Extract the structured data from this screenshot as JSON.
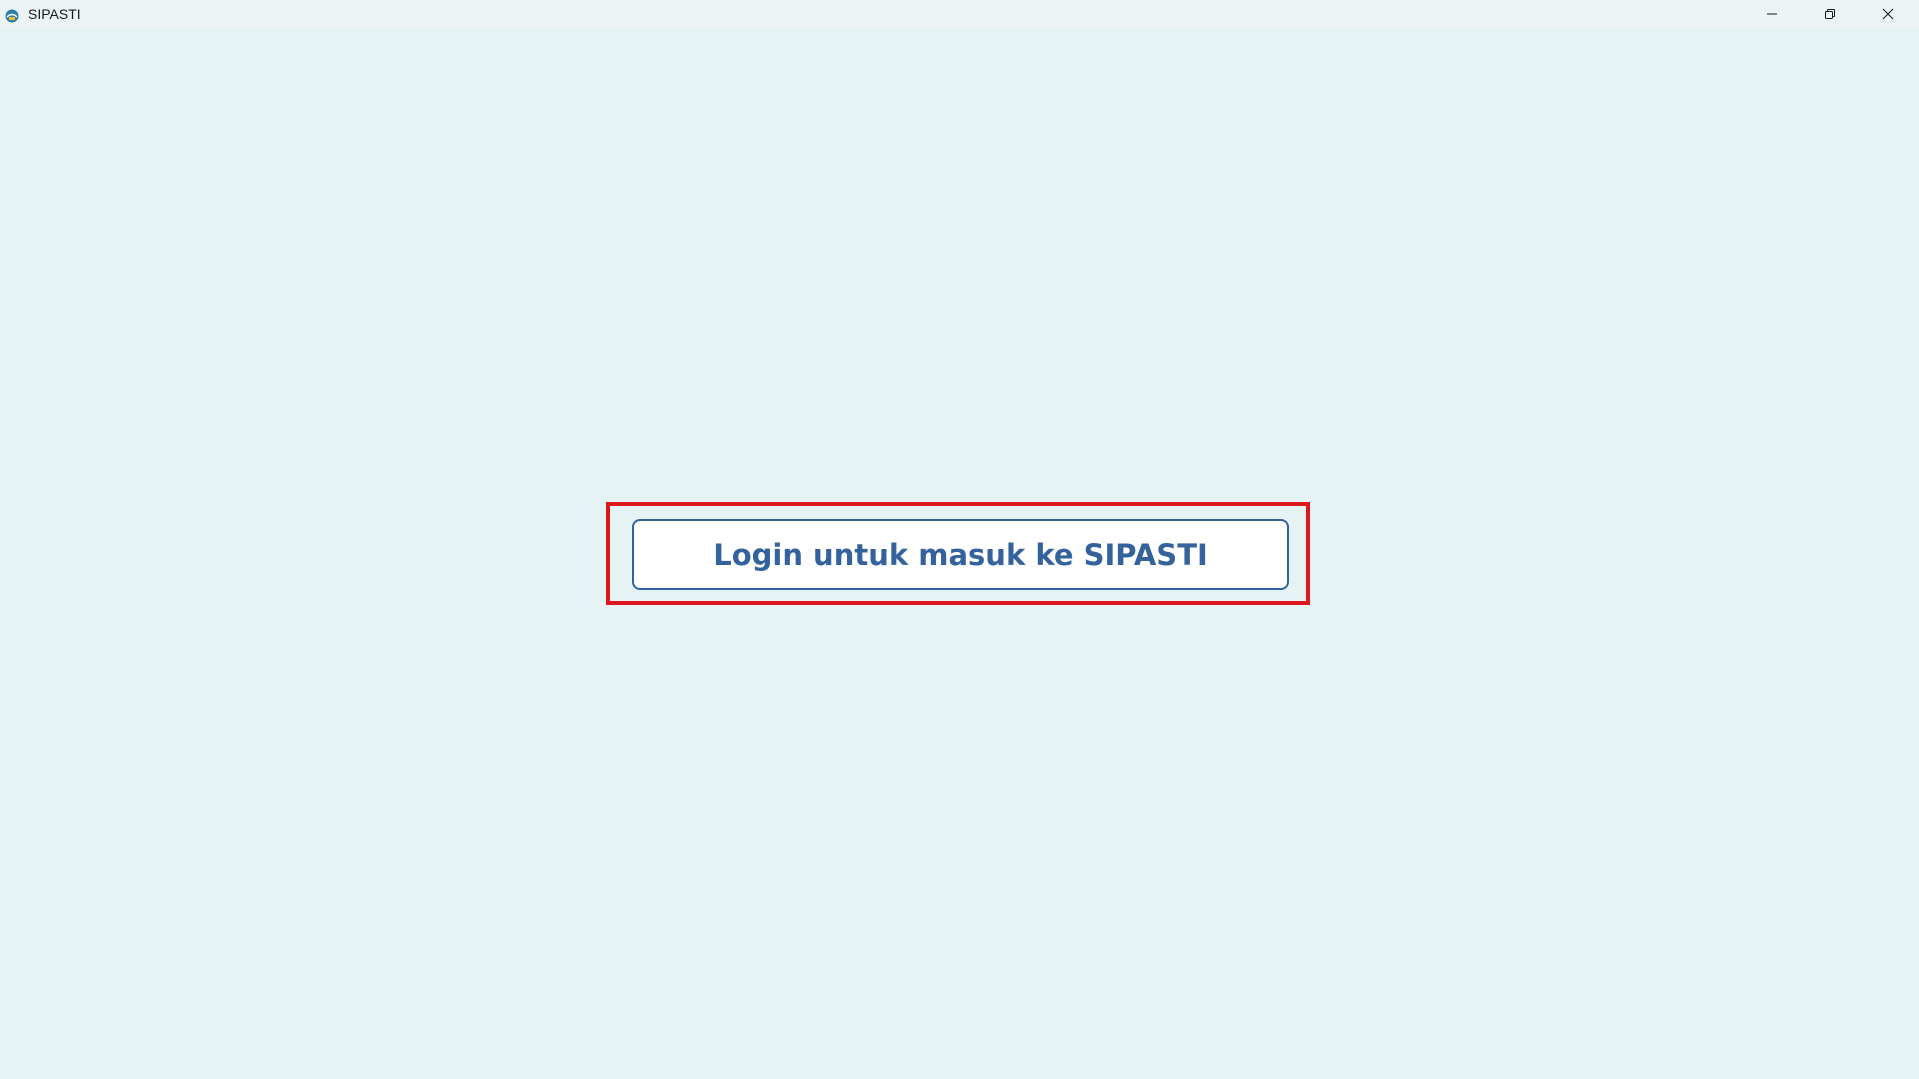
{
  "window": {
    "title": "SIPASTI",
    "controls": {
      "minimize_icon": "minimize-icon",
      "restore_icon": "restore-icon",
      "close_icon": "close-icon"
    }
  },
  "main": {
    "login_button_label": "Login untuk masuk ke SIPASTI"
  },
  "colors": {
    "background": "#e6f3f4",
    "accent": "#34629c",
    "highlight": "#e0161e"
  }
}
